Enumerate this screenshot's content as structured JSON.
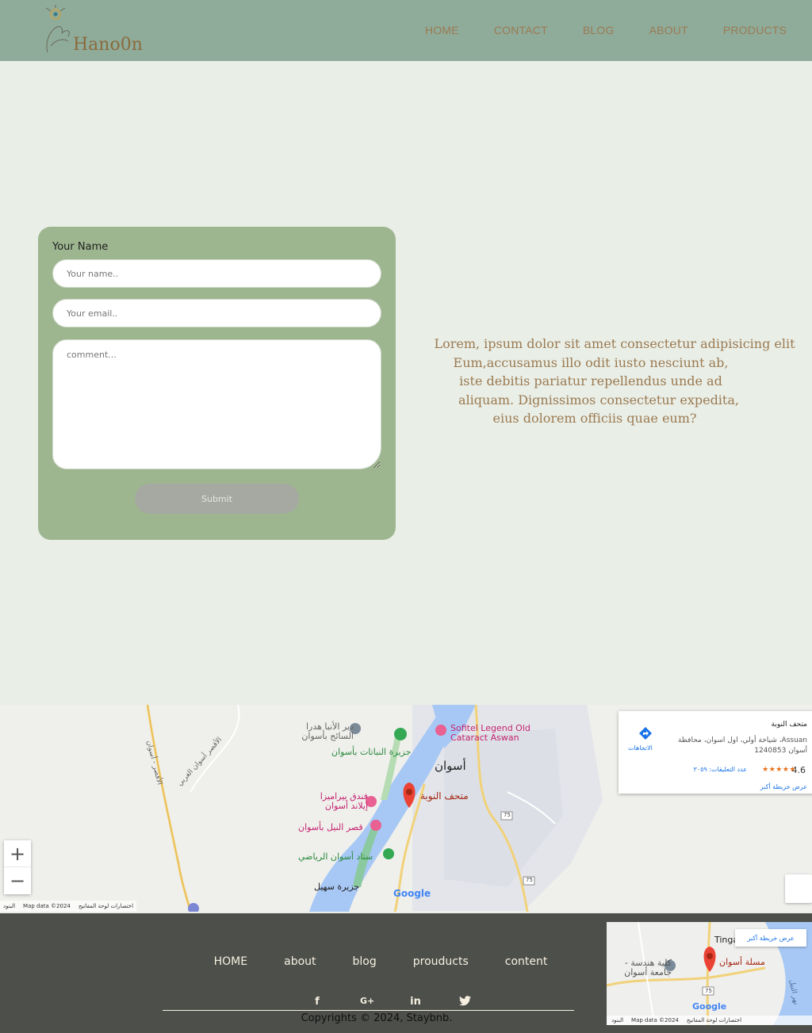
{
  "brand": {
    "name": "Hano0n"
  },
  "nav": {
    "items": [
      {
        "label": "HOME"
      },
      {
        "label": "CONTACT"
      },
      {
        "label": "BLOG"
      },
      {
        "label": "ABOUT"
      },
      {
        "label": "PRODUCTS"
      }
    ]
  },
  "form": {
    "name_label": "Your Name",
    "name_placeholder": "Your name..",
    "email_placeholder": "Your email..",
    "comment_placeholder": "comment...",
    "submit_label": "Submit"
  },
  "intro": {
    "lines": [
      "Lorem, ipsum dolor sit amet consectetur adipisicing elit",
      "Eum,accusamus illo odit iusto nesciunt ab,",
      "iste debitis pariatur repellendus unde ad",
      "aliquam. Dignissimos consectetur expedita,",
      "eius dolorem officiis quae eum?"
    ]
  },
  "map": {
    "card": {
      "place": "متحف النوبة",
      "address": "Assuan، شياخة أولي، اول اسوان، محافظة أسوان 1240853",
      "rating": "4.6",
      "stars": "★★★★★",
      "reviews": "عدد التعليقات: ٣٠٥٩",
      "larger_map": "عرض خريطة أكبر",
      "directions": "الاتجاهات"
    },
    "labels": {
      "city": "أسوان",
      "museum": "متحف النوبة",
      "sofitel": "Sofitel Legend Old Cataract Aswan",
      "botanical": "جزيرة النباتات بأسوان",
      "monastery": "دير الأنبا هدرا السائح بأسوان",
      "pyramisa": "فندق بيراميزا إيلاند أسوان",
      "nile_palace": "قصر النيل بأسوان",
      "stadium": "ستاد أسوان الرياضي",
      "sehel": "جزيرة سهيل",
      "road_left": "الأقصر - أسوان",
      "road_west": "الأقصر أسوان الغربي",
      "road_75": "75"
    },
    "zoom_in": "+",
    "zoom_out": "−",
    "attribution": {
      "keyboard": "اختصارات لوحة المفاتيح",
      "map_data": "Map data ©2024",
      "terms": "البنود"
    },
    "google": "Google"
  },
  "footer": {
    "links": [
      {
        "label": "HOME"
      },
      {
        "label": "about"
      },
      {
        "label": "blog"
      },
      {
        "label": "prouducts"
      },
      {
        "label": "content"
      }
    ],
    "socials": [
      {
        "icon": "facebook-icon",
        "glyph": "f"
      },
      {
        "icon": "google-plus-icon",
        "glyph": "G+"
      },
      {
        "icon": "linkedin-icon",
        "glyph": "in"
      },
      {
        "icon": "twitter-icon",
        "glyph": "🐦"
      }
    ],
    "copyright": "Copyrights © 2024, Staybnb.",
    "mini_map": {
      "larger_map": "عرض خريطة أكبر",
      "obelisk": "مسلة أسوان",
      "college": "كلية هندسة - جامعة أسوان",
      "tinga": "Tinga",
      "nile": "نهر النيل",
      "road": "75",
      "map_data": "Map data ©2024",
      "keyboard": "اختصارات لوحة المفاتيح",
      "terms": "البنود",
      "google": "Google"
    }
  }
}
